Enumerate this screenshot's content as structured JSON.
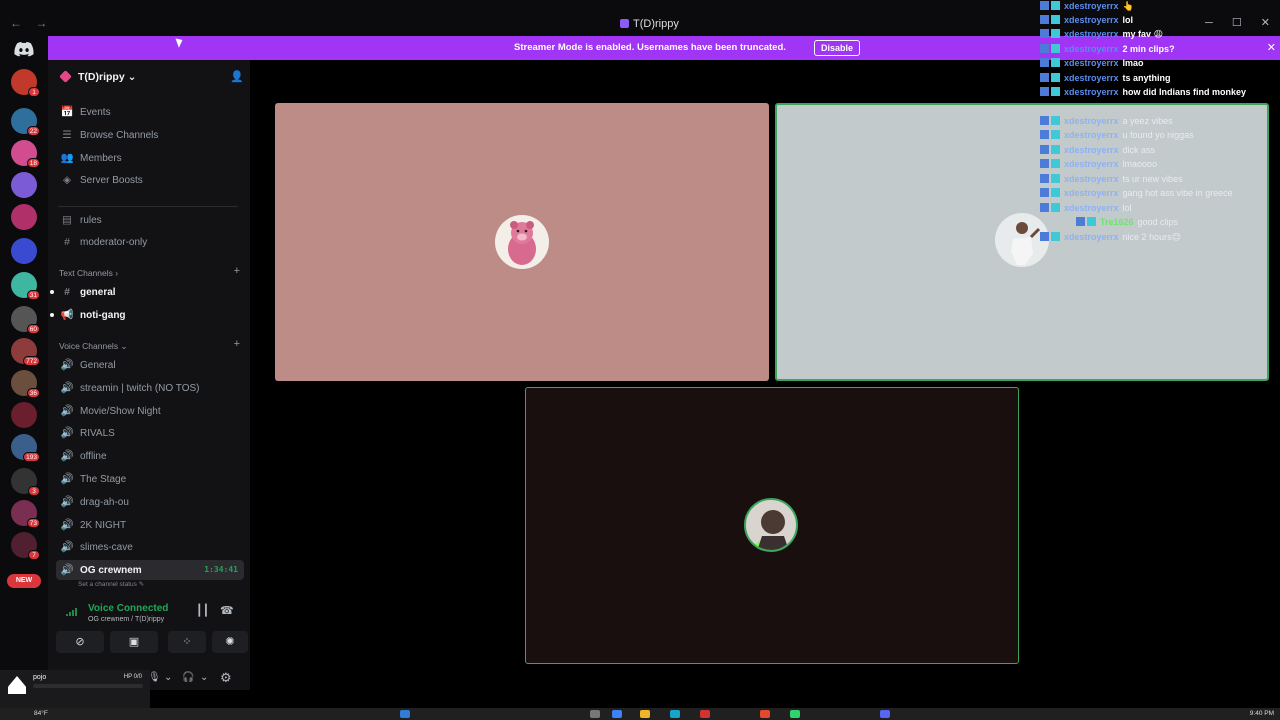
{
  "window": {
    "title": "T(D)rippy",
    "nav_back": "←",
    "nav_fwd": "→",
    "ctrl_min": "─",
    "ctrl_max": "☐",
    "ctrl_close": "✕"
  },
  "banner": {
    "text": "Streamer Mode is enabled. Usernames have been truncated.",
    "button": "Disable",
    "close": "✕"
  },
  "rail": {
    "servers": [
      {
        "badge": "1",
        "color": "#c0392b"
      },
      {
        "badge": "22",
        "color": "#2e6f9e"
      },
      {
        "badge": "18",
        "color": "#d24d8f"
      },
      {
        "badge": "",
        "color": "#7b5cd6"
      },
      {
        "badge": "",
        "color": "#b0306a"
      },
      {
        "badge": "",
        "color": "#3b4bd1"
      },
      {
        "badge": "31",
        "color": "#3fb7a0"
      },
      {
        "badge": "60",
        "color": "#555555"
      },
      {
        "badge": "772",
        "color": "#8e3b3b"
      },
      {
        "badge": "36",
        "color": "#6b4e3d"
      },
      {
        "badge": "",
        "color": "#6a1e2e"
      },
      {
        "badge": "193",
        "color": "#3a5f8a"
      },
      {
        "badge": "3",
        "color": "#333333"
      },
      {
        "badge": "73",
        "color": "#7a2f52"
      },
      {
        "badge": "7",
        "color": "#502030"
      }
    ],
    "new_label": "NEW"
  },
  "sidebar": {
    "server_name": "T(D)rippy",
    "items": [
      {
        "label": "Events",
        "icon": "📅"
      },
      {
        "label": "Browse Channels",
        "icon": "☰"
      },
      {
        "label": "Members",
        "icon": "👥"
      },
      {
        "label": "Server Boosts",
        "icon": "◈"
      }
    ],
    "top_channels": [
      {
        "label": "rules",
        "icon": "▤"
      },
      {
        "label": "moderator-only",
        "icon": "#"
      }
    ],
    "text_category": "Text Channels",
    "text_channels": [
      {
        "label": "general",
        "icon": "#"
      },
      {
        "label": "noti-gang",
        "icon": "📢"
      }
    ],
    "voice_category": "Voice Channels",
    "voice_channels": [
      {
        "label": "General"
      },
      {
        "label": "streamin | twitch (NO TOS)"
      },
      {
        "label": "Movie/Show Night"
      },
      {
        "label": "RIVALS"
      },
      {
        "label": "offline"
      },
      {
        "label": "The Stage"
      },
      {
        "label": "drag-ah-ou"
      },
      {
        "label": "2K NIGHT"
      },
      {
        "label": "slimes-cave"
      }
    ],
    "active_channel": {
      "label": "OG crewnem",
      "timer": "1:34:41",
      "status": "Set a channel status"
    }
  },
  "voice": {
    "title": "Voice Connected",
    "subtitle": "OG crewnem / T(D)rippy"
  },
  "user": {
    "name": "pojo",
    "hp": "HP 0/0",
    "hp_fraction": 0.0
  },
  "chat": [
    {
      "user": "xdestroyerrx",
      "text": "👆",
      "faded": false
    },
    {
      "user": "xdestroyerrx",
      "text": "lol",
      "faded": false
    },
    {
      "user": "xdestroyerrx",
      "text": "my fav 😩",
      "faded": false
    },
    {
      "user": "xdestroyerrx",
      "text": "2 min clips?",
      "faded": false
    },
    {
      "user": "xdestroyerrx",
      "text": "lmao",
      "faded": false
    },
    {
      "user": "xdestroyerrx",
      "text": "ts anything",
      "faded": false
    },
    {
      "user": "xdestroyerrx",
      "text": "how did Indians find monkey",
      "faded": false
    },
    {
      "user": "xdestroyerrx",
      "text": "a yeez vibes",
      "faded": true
    },
    {
      "user": "xdestroyerrx",
      "text": "u found yo niggas",
      "faded": true
    },
    {
      "user": "xdestroyerrx",
      "text": "dick ass",
      "faded": true
    },
    {
      "user": "xdestroyerrx",
      "text": "lmaoooo",
      "faded": true
    },
    {
      "user": "xdestroyerrx",
      "text": "ts ur new vibes",
      "faded": true
    },
    {
      "user": "xdestroyerrx",
      "text": "gang hot ass vibe in greece",
      "faded": true
    },
    {
      "user": "xdestroyerrx",
      "text": "lol",
      "faded": true
    },
    {
      "user": "Tre1626",
      "text": "good clips",
      "faded": true
    },
    {
      "user": "xdestroyerrx",
      "text": "nice 2 hours😊",
      "faded": true
    }
  ],
  "taskbar": {
    "weather": "84°F",
    "time": "9:40 PM"
  },
  "colors": {
    "tile1": "#bd8c87",
    "tile2": "#c2cacc",
    "tile3": "#1a0f0f",
    "speaking": "#3ba55c",
    "banner": "#a035f5"
  }
}
